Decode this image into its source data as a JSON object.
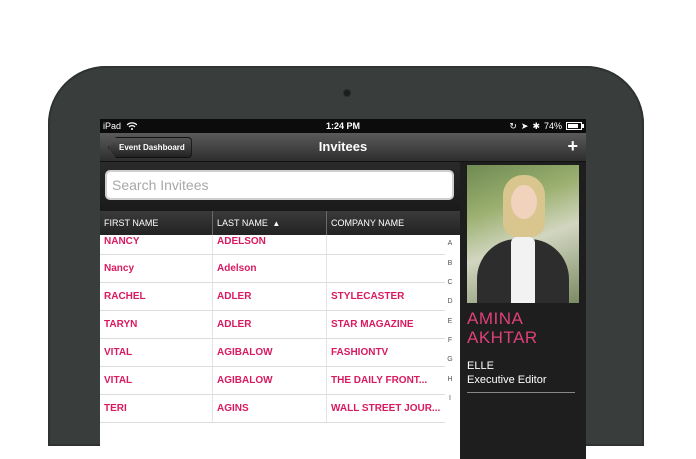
{
  "status_bar": {
    "carrier": "iPad",
    "time": "1:24 PM",
    "battery": "74%"
  },
  "nav": {
    "back_label": "Event Dashboard",
    "title": "Invitees",
    "add_label": "+"
  },
  "search": {
    "placeholder": "Search Invitees"
  },
  "table": {
    "headers": [
      "FIRST NAME",
      "LAST NAME",
      "COMPANY NAME"
    ],
    "sort_indicator": "▲",
    "rows": [
      {
        "first": "NANCY",
        "last": "ADELSON",
        "company": ""
      },
      {
        "first": "Nancy",
        "last": "Adelson",
        "company": ""
      },
      {
        "first": "RACHEL",
        "last": "ADLER",
        "company": "STYLECASTER"
      },
      {
        "first": "TARYN",
        "last": "ADLER",
        "company": "STAR MAGAZINE"
      },
      {
        "first": "VITAL",
        "last": "AGIBALOW",
        "company": "FASHIONTV"
      },
      {
        "first": "VITAL",
        "last": "AGIBALOW",
        "company": "THE DAILY FRONT..."
      },
      {
        "first": "TERI",
        "last": "AGINS",
        "company": "WALL STREET JOUR..."
      }
    ],
    "index_letters": [
      "A",
      "B",
      "C",
      "D",
      "E",
      "F",
      "G",
      "H",
      "I"
    ]
  },
  "profile": {
    "first_name": "AMINA",
    "last_name": "AKHTAR",
    "company": "ELLE",
    "title": "Executive Editor"
  },
  "colors": {
    "accent_pink": "#d81b60",
    "device_frame": "#393d3c"
  }
}
